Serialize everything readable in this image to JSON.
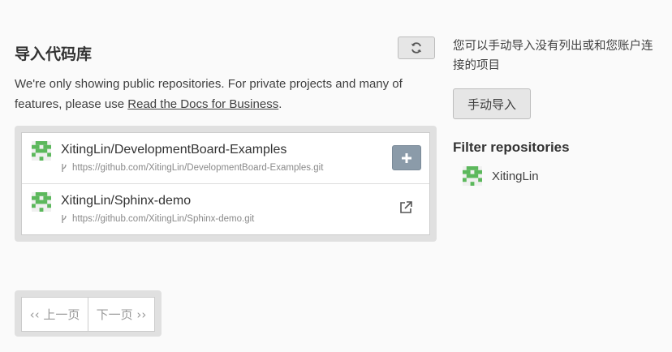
{
  "header": {
    "title": "导入代码库"
  },
  "intro": {
    "text": "We're only showing public repositories. For private projects and many of features, please use ",
    "link": "Read the Docs for Business",
    "suffix": "."
  },
  "repos": [
    {
      "name": "XitingLin/DevelopmentBoard-Examples",
      "url": "https://github.com/XitingLin/DevelopmentBoard-Examples.git",
      "action": "plus-icon"
    },
    {
      "name": "XitingLin/Sphinx-demo",
      "url": "https://github.com/XitingLin/Sphinx-demo.git",
      "action": "external-link-icon"
    }
  ],
  "pagination": {
    "prev": "‹‹ 上一页",
    "next": "下一页 ››"
  },
  "sidebar": {
    "note": "您可以手动导入没有列出或和您账户连接的项目",
    "manual_import": "手动导入",
    "filter_title": "Filter repositories",
    "filter_items": [
      {
        "label": "XitingLin"
      }
    ]
  },
  "colors": {
    "accent_button": "#8b9ba9",
    "avatar_green": "#5cb85c"
  }
}
